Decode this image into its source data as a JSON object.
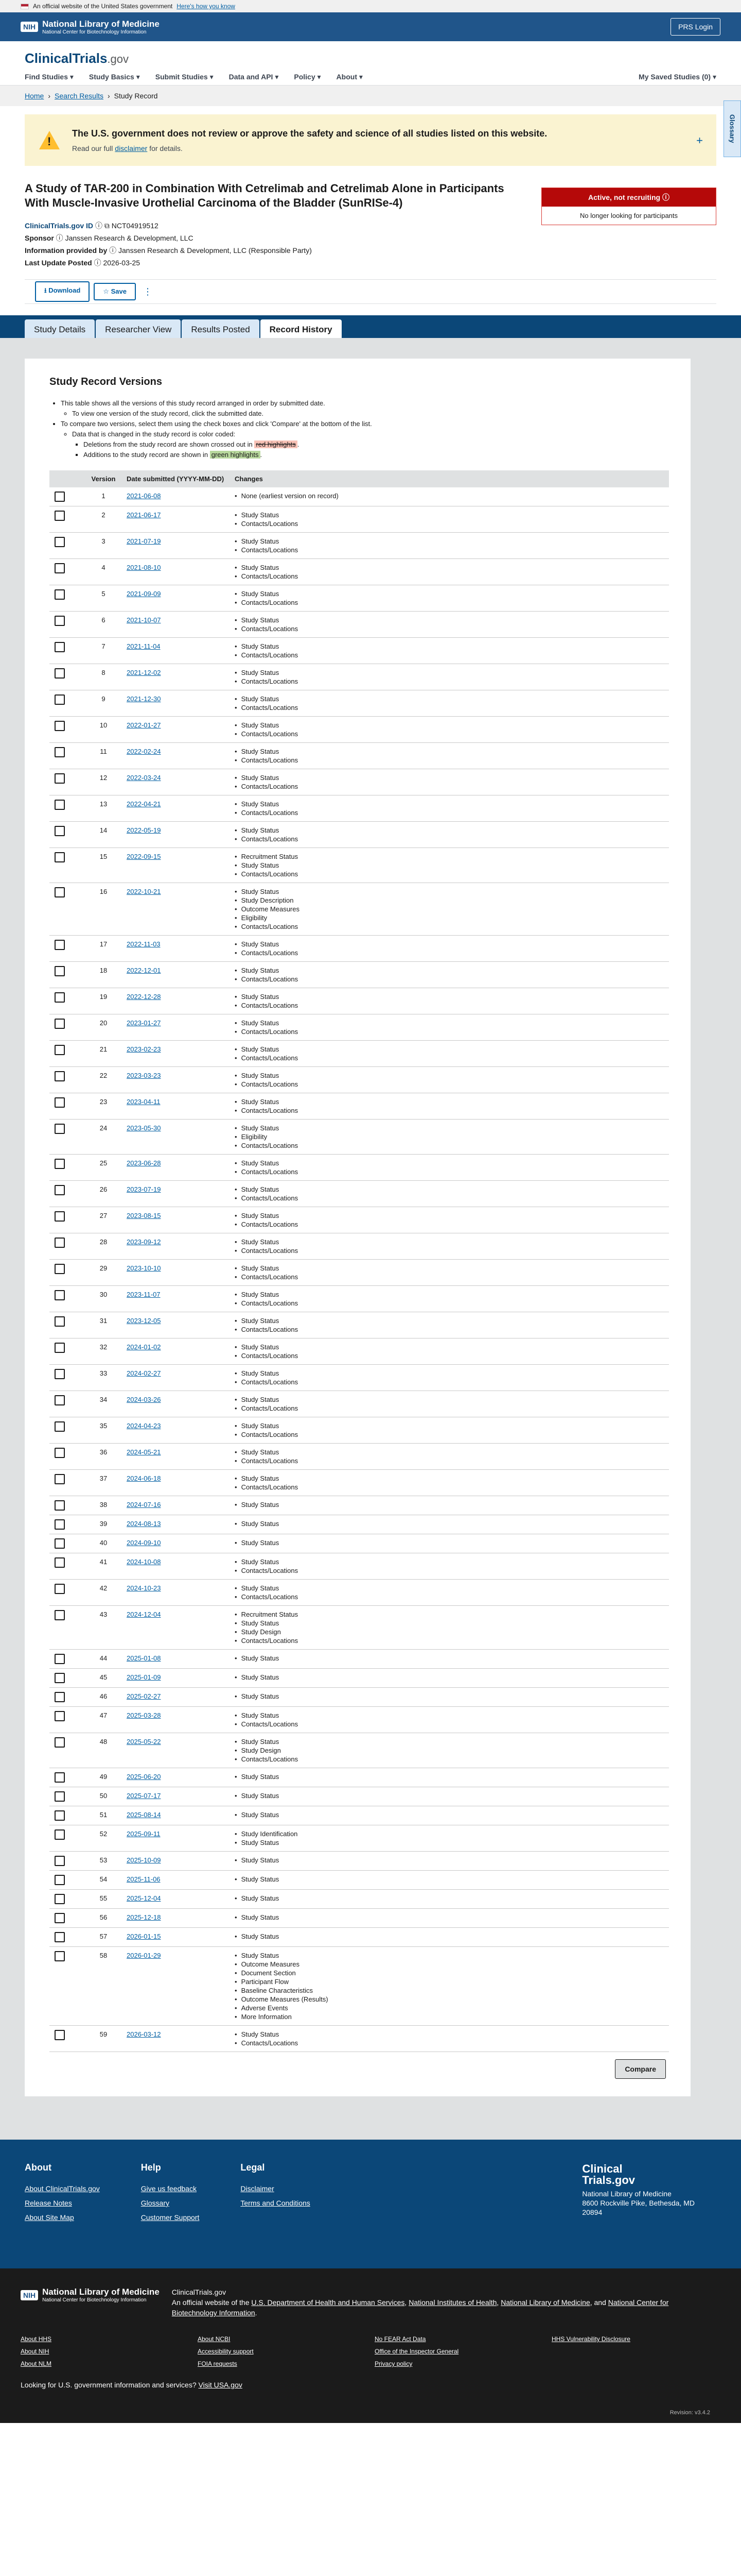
{
  "gov_banner": {
    "text": "An official website of the United States government",
    "link": "Here's how you know"
  },
  "nlm": {
    "brand": "National Library of Medicine",
    "sub": "National Center for Biotechnology Information",
    "prs": "PRS Login",
    "nih": "NIH"
  },
  "header": {
    "logo_main": "ClinicalTrials",
    "logo_suffix": ".gov",
    "nav": [
      "Find Studies",
      "Study Basics",
      "Submit Studies",
      "Data and API",
      "Policy",
      "About"
    ],
    "saved": "My Saved Studies (0)",
    "glossary": "Glossary"
  },
  "breadcrumb": [
    "Home",
    "Search Results",
    "Study Record"
  ],
  "warning": {
    "title": "The U.S. government does not review or approve the safety and science of all studies listed on this website.",
    "pre": "Read our full",
    "link": "disclaimer",
    "post": "for details."
  },
  "study": {
    "title": "A Study of TAR-200 in Combination With Cetrelimab and Cetrelimab Alone in Participants With Muscle-Invasive Urothelial Carcinoma of the Bladder (SunRISe-4)",
    "id_label": "ClinicalTrials.gov ID",
    "nct": "NCT04919512",
    "sponsor_label": "Sponsor",
    "sponsor": "Janssen Research & Development, LLC",
    "info_label": "Information provided by",
    "info": "Janssen Research & Development, LLC (Responsible Party)",
    "update_label": "Last Update Posted",
    "update": "2026-03-25"
  },
  "status": {
    "title": "Active, not recruiting",
    "sub": "No longer looking for participants"
  },
  "actions": {
    "download": "Download",
    "save": "Save"
  },
  "tabs": [
    "Study Details",
    "Researcher View",
    "Results Posted",
    "Record History"
  ],
  "history": {
    "heading": "Study Record Versions",
    "intro": "This table shows all the versions of this study record arranged in order by submitted date.",
    "view": "To view one version of the study record, click the submitted date.",
    "compare": "To compare two versions, select them using the check boxes and click 'Compare' at the bottom of the list.",
    "color": "Data that is changed in the study record is color coded:",
    "deletions": "Deletions from the study record are shown crossed out in",
    "deletions_hl": "red highlights",
    "additions": "Additions to the study record are shown in",
    "additions_hl": "green highlights",
    "col_version": "Version",
    "col_date": "Date submitted (YYYY-MM-DD)",
    "col_changes": "Changes",
    "compare_btn": "Compare"
  },
  "versions": [
    {
      "v": "1",
      "d": "2021-06-08",
      "c": [
        "None (earliest version on record)"
      ]
    },
    {
      "v": "2",
      "d": "2021-06-17",
      "c": [
        "Study Status",
        "Contacts/Locations"
      ]
    },
    {
      "v": "3",
      "d": "2021-07-19",
      "c": [
        "Study Status",
        "Contacts/Locations"
      ]
    },
    {
      "v": "4",
      "d": "2021-08-10",
      "c": [
        "Study Status",
        "Contacts/Locations"
      ]
    },
    {
      "v": "5",
      "d": "2021-09-09",
      "c": [
        "Study Status",
        "Contacts/Locations"
      ]
    },
    {
      "v": "6",
      "d": "2021-10-07",
      "c": [
        "Study Status",
        "Contacts/Locations"
      ]
    },
    {
      "v": "7",
      "d": "2021-11-04",
      "c": [
        "Study Status",
        "Contacts/Locations"
      ]
    },
    {
      "v": "8",
      "d": "2021-12-02",
      "c": [
        "Study Status",
        "Contacts/Locations"
      ]
    },
    {
      "v": "9",
      "d": "2021-12-30",
      "c": [
        "Study Status",
        "Contacts/Locations"
      ]
    },
    {
      "v": "10",
      "d": "2022-01-27",
      "c": [
        "Study Status",
        "Contacts/Locations"
      ]
    },
    {
      "v": "11",
      "d": "2022-02-24",
      "c": [
        "Study Status",
        "Contacts/Locations"
      ]
    },
    {
      "v": "12",
      "d": "2022-03-24",
      "c": [
        "Study Status",
        "Contacts/Locations"
      ]
    },
    {
      "v": "13",
      "d": "2022-04-21",
      "c": [
        "Study Status",
        "Contacts/Locations"
      ]
    },
    {
      "v": "14",
      "d": "2022-05-19",
      "c": [
        "Study Status",
        "Contacts/Locations"
      ]
    },
    {
      "v": "15",
      "d": "2022-09-15",
      "c": [
        "Recruitment Status",
        "Study Status",
        "Contacts/Locations"
      ]
    },
    {
      "v": "16",
      "d": "2022-10-21",
      "c": [
        "Study Status",
        "Study Description",
        "Outcome Measures",
        "Eligibility",
        "Contacts/Locations"
      ]
    },
    {
      "v": "17",
      "d": "2022-11-03",
      "c": [
        "Study Status",
        "Contacts/Locations"
      ]
    },
    {
      "v": "18",
      "d": "2022-12-01",
      "c": [
        "Study Status",
        "Contacts/Locations"
      ]
    },
    {
      "v": "19",
      "d": "2022-12-28",
      "c": [
        "Study Status",
        "Contacts/Locations"
      ]
    },
    {
      "v": "20",
      "d": "2023-01-27",
      "c": [
        "Study Status",
        "Contacts/Locations"
      ]
    },
    {
      "v": "21",
      "d": "2023-02-23",
      "c": [
        "Study Status",
        "Contacts/Locations"
      ]
    },
    {
      "v": "22",
      "d": "2023-03-23",
      "c": [
        "Study Status",
        "Contacts/Locations"
      ]
    },
    {
      "v": "23",
      "d": "2023-04-11",
      "c": [
        "Study Status",
        "Contacts/Locations"
      ]
    },
    {
      "v": "24",
      "d": "2023-05-30",
      "c": [
        "Study Status",
        "Eligibility",
        "Contacts/Locations"
      ]
    },
    {
      "v": "25",
      "d": "2023-06-28",
      "c": [
        "Study Status",
        "Contacts/Locations"
      ]
    },
    {
      "v": "26",
      "d": "2023-07-19",
      "c": [
        "Study Status",
        "Contacts/Locations"
      ]
    },
    {
      "v": "27",
      "d": "2023-08-15",
      "c": [
        "Study Status",
        "Contacts/Locations"
      ]
    },
    {
      "v": "28",
      "d": "2023-09-12",
      "c": [
        "Study Status",
        "Contacts/Locations"
      ]
    },
    {
      "v": "29",
      "d": "2023-10-10",
      "c": [
        "Study Status",
        "Contacts/Locations"
      ]
    },
    {
      "v": "30",
      "d": "2023-11-07",
      "c": [
        "Study Status",
        "Contacts/Locations"
      ]
    },
    {
      "v": "31",
      "d": "2023-12-05",
      "c": [
        "Study Status",
        "Contacts/Locations"
      ]
    },
    {
      "v": "32",
      "d": "2024-01-02",
      "c": [
        "Study Status",
        "Contacts/Locations"
      ]
    },
    {
      "v": "33",
      "d": "2024-02-27",
      "c": [
        "Study Status",
        "Contacts/Locations"
      ]
    },
    {
      "v": "34",
      "d": "2024-03-26",
      "c": [
        "Study Status",
        "Contacts/Locations"
      ]
    },
    {
      "v": "35",
      "d": "2024-04-23",
      "c": [
        "Study Status",
        "Contacts/Locations"
      ]
    },
    {
      "v": "36",
      "d": "2024-05-21",
      "c": [
        "Study Status",
        "Contacts/Locations"
      ]
    },
    {
      "v": "37",
      "d": "2024-06-18",
      "c": [
        "Study Status",
        "Contacts/Locations"
      ]
    },
    {
      "v": "38",
      "d": "2024-07-16",
      "c": [
        "Study Status"
      ]
    },
    {
      "v": "39",
      "d": "2024-08-13",
      "c": [
        "Study Status"
      ]
    },
    {
      "v": "40",
      "d": "2024-09-10",
      "c": [
        "Study Status"
      ]
    },
    {
      "v": "41",
      "d": "2024-10-08",
      "c": [
        "Study Status",
        "Contacts/Locations"
      ]
    },
    {
      "v": "42",
      "d": "2024-10-23",
      "c": [
        "Study Status",
        "Contacts/Locations"
      ]
    },
    {
      "v": "43",
      "d": "2024-12-04",
      "c": [
        "Recruitment Status",
        "Study Status",
        "Study Design",
        "Contacts/Locations"
      ]
    },
    {
      "v": "44",
      "d": "2025-01-08",
      "c": [
        "Study Status"
      ]
    },
    {
      "v": "45",
      "d": "2025-01-09",
      "c": [
        "Study Status"
      ]
    },
    {
      "v": "46",
      "d": "2025-02-27",
      "c": [
        "Study Status"
      ]
    },
    {
      "v": "47",
      "d": "2025-03-28",
      "c": [
        "Study Status",
        "Contacts/Locations"
      ]
    },
    {
      "v": "48",
      "d": "2025-05-22",
      "c": [
        "Study Status",
        "Study Design",
        "Contacts/Locations"
      ]
    },
    {
      "v": "49",
      "d": "2025-06-20",
      "c": [
        "Study Status"
      ]
    },
    {
      "v": "50",
      "d": "2025-07-17",
      "c": [
        "Study Status"
      ]
    },
    {
      "v": "51",
      "d": "2025-08-14",
      "c": [
        "Study Status"
      ]
    },
    {
      "v": "52",
      "d": "2025-09-11",
      "c": [
        "Study Identification",
        "Study Status"
      ]
    },
    {
      "v": "53",
      "d": "2025-10-09",
      "c": [
        "Study Status"
      ]
    },
    {
      "v": "54",
      "d": "2025-11-06",
      "c": [
        "Study Status"
      ]
    },
    {
      "v": "55",
      "d": "2025-12-04",
      "c": [
        "Study Status"
      ]
    },
    {
      "v": "56",
      "d": "2025-12-18",
      "c": [
        "Study Status"
      ]
    },
    {
      "v": "57",
      "d": "2026-01-15",
      "c": [
        "Study Status"
      ]
    },
    {
      "v": "58",
      "d": "2026-01-29",
      "c": [
        "Study Status",
        "Outcome Measures",
        "Document Section",
        "Participant Flow",
        "Baseline Characteristics",
        "Outcome Measures (Results)",
        "Adverse Events",
        "More Information"
      ]
    },
    {
      "v": "59",
      "d": "2026-03-12",
      "c": [
        "Study Status",
        "Contacts/Locations"
      ]
    }
  ],
  "footer": {
    "cols": [
      {
        "title": "About",
        "links": [
          "About ClinicalTrials.gov",
          "Release Notes",
          "About Site Map"
        ]
      },
      {
        "title": "Help",
        "links": [
          "Give us feedback",
          "Glossary",
          "Customer Support"
        ]
      },
      {
        "title": "Legal",
        "links": [
          "Disclaimer",
          "Terms and Conditions"
        ]
      }
    ],
    "brand_main": "Clinical",
    "brand_sub": "Trials.gov",
    "lib": "National Library of Medicine",
    "addr": "8600 Rockville Pike, Bethesda, MD",
    "zip": "20894"
  },
  "footer_dark": {
    "site": "ClinicalTrials.gov",
    "pre": "An official website of the",
    "hhs": "U.S. Department of Health and Human Services",
    "nih": "National Institutes of Health",
    "nlm": "National Library of Medicine",
    "and": "and",
    "ncbi": "National Center for Biotechnology Information",
    "links": [
      "About HHS",
      "About NCBI",
      "No FEAR Act Data",
      "HHS Vulnerability Disclosure",
      "About NIH",
      "Accessibility support",
      "Office of the Inspector General",
      "",
      "About NLM",
      "FOIA requests",
      "Privacy policy",
      ""
    ],
    "q": "Looking for U.S. government information and services?",
    "q_link": "Visit USA.gov",
    "rev": "Revision: v3.4.2"
  }
}
